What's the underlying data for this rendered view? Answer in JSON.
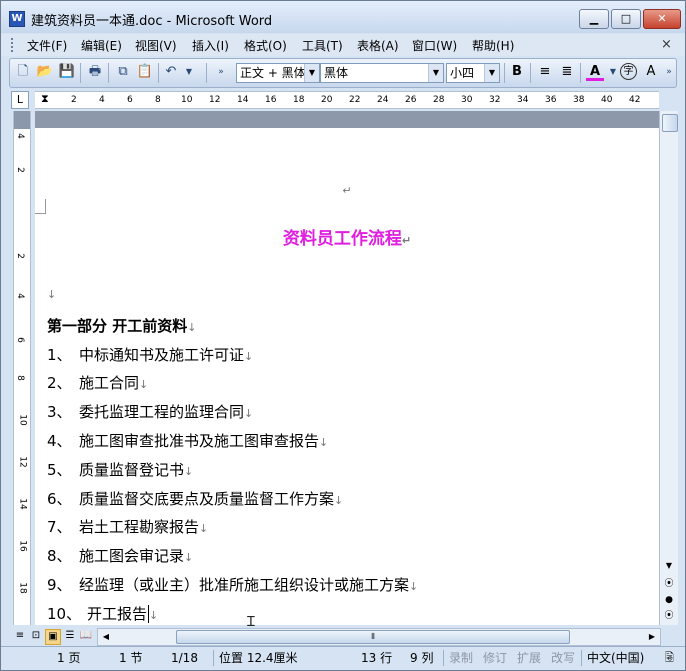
{
  "window": {
    "title": "建筑资料员一本通.doc - Microsoft Word",
    "app_icon": "W"
  },
  "menu": {
    "items": [
      "文件(F)",
      "编辑(E)",
      "视图(V)",
      "插入(I)",
      "格式(O)",
      "工具(T)",
      "表格(A)",
      "窗口(W)",
      "帮助(H)"
    ],
    "close_doc": "×"
  },
  "toolbar": {
    "style_value": "正文 + 黑体",
    "font_value": "黑体",
    "size_value": "小四",
    "bold_label": "B",
    "font_color_label": "A",
    "pinyin_label": "字",
    "grow_label": "A"
  },
  "ruler": {
    "corner_label": "L",
    "h_ticks": [
      "2",
      "2",
      "4",
      "6",
      "8",
      "10",
      "12",
      "14",
      "16",
      "18",
      "20",
      "22",
      "24",
      "26",
      "28",
      "30",
      "32",
      "34",
      "36",
      "38",
      "40",
      "42"
    ],
    "v_ticks": [
      "4",
      "2",
      "2",
      "4",
      "6",
      "8",
      "10",
      "12",
      "14",
      "16",
      "18"
    ]
  },
  "document": {
    "top_mark": "↵",
    "title": "资料员工作流程",
    "title_color": "#e01ee0",
    "blank_mark": "↓",
    "section_heading": "第一部分  开工前资料",
    "items": [
      {
        "num": "1、",
        "text": "中标通知书及施工许可证"
      },
      {
        "num": "2、",
        "text": "施工合同"
      },
      {
        "num": "3、",
        "text": "委托监理工程的监理合同"
      },
      {
        "num": "4、",
        "text": "施工图审查批准书及施工图审查报告"
      },
      {
        "num": "5、",
        "text": "质量监督登记书"
      },
      {
        "num": "6、",
        "text": "质量监督交底要点及质量监督工作方案"
      },
      {
        "num": "7、",
        "text": "岩土工程勘察报告"
      },
      {
        "num": "8、",
        "text": "施工图会审记录"
      },
      {
        "num": "9、",
        "text": "经监理（或业主）批准所施工组织设计或施工方案"
      },
      {
        "num": "10、",
        "text": "开工报告"
      }
    ],
    "line_mark": "↓"
  },
  "statusbar": {
    "page": "1 页",
    "section": "1 节",
    "pages": "1/18",
    "position": "位置 12.4厘米",
    "line": "13 行",
    "column": "9 列",
    "rec": "录制",
    "trk": "修订",
    "ext": "扩展",
    "ovr": "改写",
    "language": "中文(中国)"
  }
}
